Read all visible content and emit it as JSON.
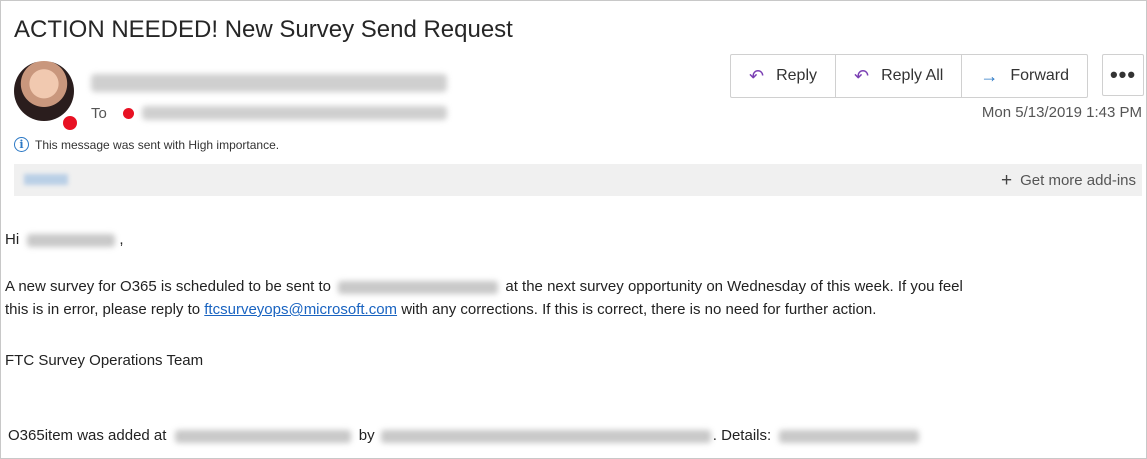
{
  "email": {
    "subject": "ACTION NEEDED! New Survey Send Request",
    "to_label": "To",
    "importance_notice": "This message was sent with High importance.",
    "date": "Mon 5/13/2019 1:43 PM",
    "get_addins": "Get more add-ins"
  },
  "actions": {
    "reply": "Reply",
    "reply_all": "Reply All",
    "forward": "Forward",
    "more": "•••"
  },
  "body": {
    "greeting_prefix": "Hi",
    "greeting_suffix": ",",
    "p1_start": "A new survey for O365 is scheduled to be sent to",
    "p1_mid": "at the next survey opportunity on Wednesday of this week. If you feel",
    "p1_line2_start": "this is in error, please reply to",
    "email_link": "ftcsurveyops@microsoft.com",
    "p1_end": "with any corrections. If this is correct, there is no need for further action.",
    "signature": "FTC Survey Operations Team",
    "footer_start": "O365item was added at",
    "footer_by": "by",
    "footer_details": ". Details:"
  }
}
